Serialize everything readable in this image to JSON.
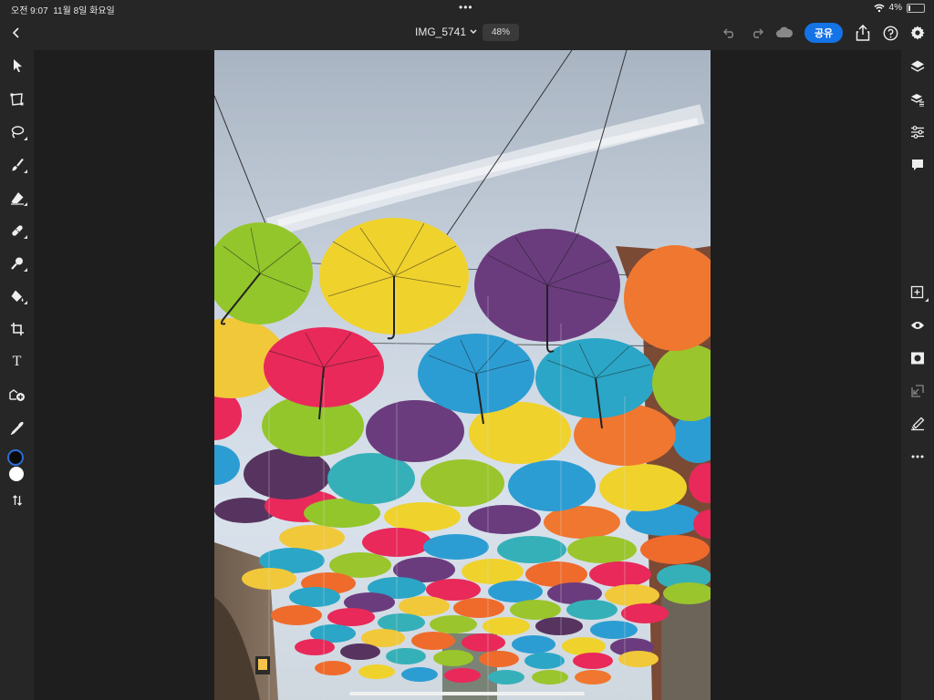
{
  "status": {
    "time": "오전 9:07",
    "date": "11월 8일 화요일",
    "battery": "4%",
    "multitask_dots": "•••"
  },
  "topbar": {
    "doc_title": "IMG_5741",
    "zoom": "48%",
    "share_label": "공유"
  },
  "left_tools": [
    {
      "name": "select-tool",
      "icon": "arrow-pointer-icon"
    },
    {
      "name": "transform-tool",
      "icon": "transform-icon"
    },
    {
      "name": "lasso-tool",
      "icon": "lasso-icon"
    },
    {
      "name": "brush-tool",
      "icon": "brush-icon"
    },
    {
      "name": "eraser-tool",
      "icon": "eraser-icon"
    },
    {
      "name": "healing-tool",
      "icon": "bandage-icon"
    },
    {
      "name": "clone-tool",
      "icon": "stamp-icon"
    },
    {
      "name": "fill-tool",
      "icon": "paint-bucket-icon"
    },
    {
      "name": "crop-tool",
      "icon": "crop-icon"
    },
    {
      "name": "type-tool",
      "icon": "type-icon"
    },
    {
      "name": "place-image-tool",
      "icon": "add-image-icon"
    },
    {
      "name": "eyedropper-tool",
      "icon": "eyedropper-icon"
    }
  ],
  "type_tool_glyph": "T",
  "colors": {
    "accent": "#1473e6",
    "foreground_swatch": "#0a0a0a",
    "background_swatch": "#ffffff",
    "panel": "#262626",
    "canvas": "#1e1e1e"
  },
  "right_tools": [
    {
      "name": "layers",
      "icon": "layers-icon"
    },
    {
      "name": "layer-properties",
      "icon": "layer-properties-icon"
    },
    {
      "name": "adjustments",
      "icon": "sliders-icon"
    },
    {
      "name": "comments",
      "icon": "comment-icon"
    },
    {
      "name": "add-layer",
      "icon": "add-layer-icon"
    },
    {
      "name": "visibility",
      "icon": "eye-icon"
    },
    {
      "name": "mask",
      "icon": "mask-icon"
    },
    {
      "name": "clipping",
      "icon": "clip-icon"
    },
    {
      "name": "layer-effects",
      "icon": "effects-icon"
    },
    {
      "name": "more",
      "icon": "more-icon"
    }
  ]
}
